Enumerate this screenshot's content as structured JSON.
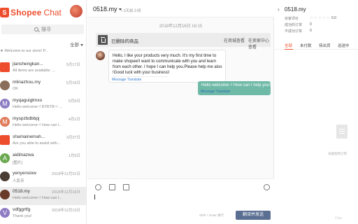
{
  "brand": {
    "logo": "S",
    "name": "Shopee",
    "suffix": "Chat",
    "color": "#ee4d2d"
  },
  "sidebar": {
    "search_placeholder": "搜寻",
    "filter_label": "全部",
    "conversations": [
      {
        "name": "",
        "date": "",
        "preview": "★ Welcome to our store! P...",
        "avatar": "",
        "avatar_color": ""
      },
      {
        "name": "jianshengkan...",
        "date": "5月17日",
        "preview": "All items are available. ...",
        "avatar": "shop",
        "avatar_color": "#ee4d2d"
      },
      {
        "name": "mlinazhou.my",
        "date": "5月16日",
        "preview": "OK",
        "avatar": "photo",
        "avatar_color": "#8a6d5a"
      },
      {
        "name": "myqaguigtmxo",
        "date": "5月5日",
        "preview": "Hello welcome~! BTBTB~! ...",
        "avatar": "M",
        "avatar_color": "#8e7cc3"
      },
      {
        "name": "myspzbdbbpj",
        "date": "4月1日",
        "preview": "Hello welcome~! How can I...",
        "avatar": "M",
        "avatar_color": "#e07b5a"
      },
      {
        "name": "shamainemah...",
        "date": "3月27日",
        "preview": "Are you able to assist with...",
        "avatar": "shop",
        "avatar_color": "#ee4d2d"
      },
      {
        "name": "aidilnazwa",
        "date": "1月5日",
        "preview": "[图片]",
        "avatar": "A",
        "avatar_color": "#6aa84f"
      },
      {
        "name": "yenyensiow",
        "date": "2018年12月31日",
        "preview": "人民币",
        "avatar": "photo",
        "avatar_color": "#4a3b33"
      },
      {
        "name": "0518.my",
        "date": "2018年12月16日",
        "preview": "Hello welcome~! How can I...",
        "avatar": "photo",
        "avatar_color": "#6b3b2a"
      },
      {
        "name": "vdfggrtfg",
        "date": "2018年12月13日",
        "preview": "Thank you!",
        "avatar": "V",
        "avatar_color": "#8e7cc3"
      }
    ]
  },
  "chat": {
    "user": "0518.my",
    "status": "• 3天前上线",
    "timestamp": "2018年12月16日 16:15",
    "card": {
      "label": "已删除的商品",
      "link1": "在商城查看",
      "separator": "|",
      "link2": "在卖家中心查看"
    },
    "incoming": {
      "text": "Hello, I like your products very much. It's my first time to make shopee!I want to communicate with you and learn from each other. I hope I can help you.Please help me also !Good luck with your business!",
      "translate": "Message Translate"
    },
    "outgoing": {
      "text": "Hello welcome~! How can I help you?",
      "translate": "Message Translate"
    },
    "composer": {
      "hint": "Shift + Enter 换行",
      "send_label": "翻译并发送"
    }
  },
  "panel": {
    "user": "0518.my",
    "rows": [
      {
        "label": "买家评价",
        "value": "0.0"
      },
      {
        "label": "成功的订单",
        "value": "0"
      },
      {
        "label": "不成功订单",
        "value": "0"
      }
    ],
    "stars": "☆☆☆☆☆",
    "tabs": [
      "全部",
      "未付款",
      "待出货",
      "运送中"
    ],
    "active_tab": 0,
    "empty_text": "未能找到订单",
    "watermark": "Ciao"
  }
}
